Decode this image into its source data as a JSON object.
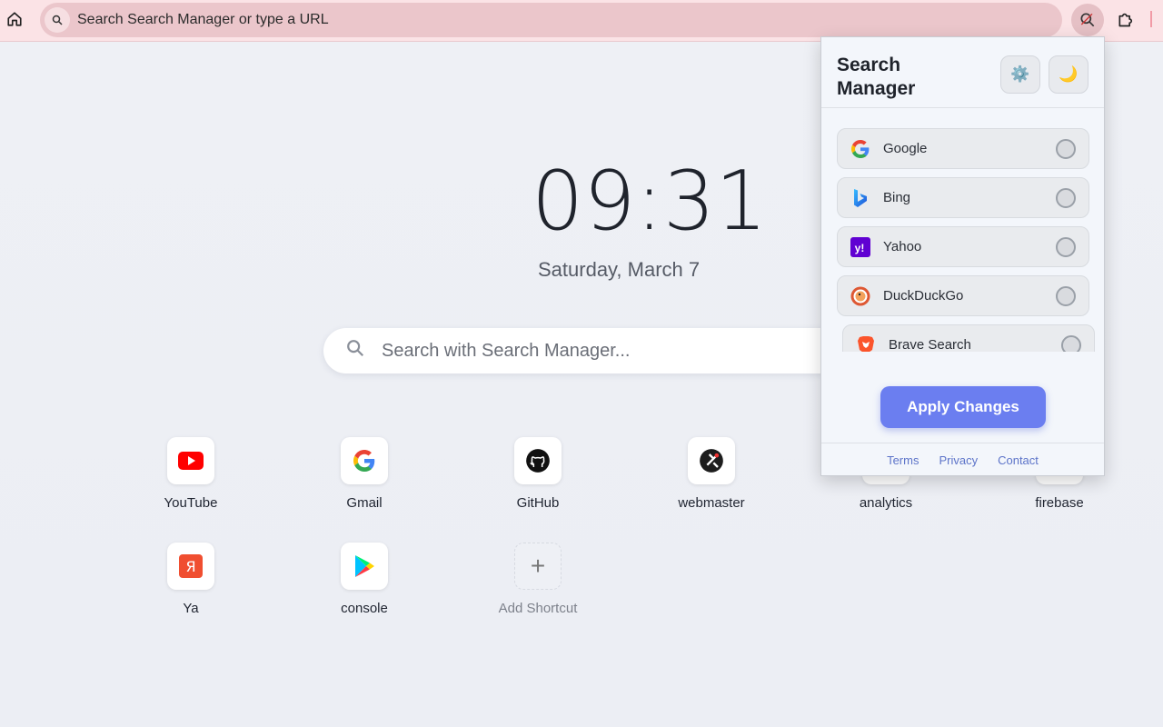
{
  "browser": {
    "omnibox_text": "Search Search Manager or type a URL"
  },
  "newtab": {
    "time": "09:31",
    "date": "Saturday, March 7",
    "search_placeholder": "Search with Search Manager...",
    "shortcuts": [
      {
        "label": "YouTube",
        "icon": "youtube-icon"
      },
      {
        "label": "Gmail",
        "icon": "google-icon"
      },
      {
        "label": "GitHub",
        "icon": "github-icon"
      },
      {
        "label": "webmaster",
        "icon": "webmaster-icon"
      },
      {
        "label": "analytics",
        "icon": "analytics-icon"
      },
      {
        "label": "firebase",
        "icon": "firebase-icon"
      },
      {
        "label": "Ya",
        "icon": "yandex-icon"
      },
      {
        "label": "console",
        "icon": "google-play-icon"
      }
    ],
    "add_shortcut_label": "Add Shortcut"
  },
  "popup": {
    "title": "Search Manager",
    "settings_icon": "gear-icon",
    "theme_icon": "moon-icon",
    "engines": [
      {
        "name": "Google",
        "icon": "google-icon",
        "selected": false
      },
      {
        "name": "Bing",
        "icon": "bing-icon",
        "selected": false
      },
      {
        "name": "Yahoo",
        "icon": "yahoo-icon",
        "selected": false
      },
      {
        "name": "DuckDuckGo",
        "icon": "duckduckgo-icon",
        "selected": false
      },
      {
        "name": "Brave Search",
        "icon": "brave-icon",
        "selected": false
      }
    ],
    "apply_label": "Apply Changes",
    "footer": {
      "terms": "Terms",
      "privacy": "Privacy",
      "contact": "Contact"
    }
  },
  "colors": {
    "accent": "#6b7ef0",
    "topbar": "#fbe3e6",
    "omnibox": "#ebc6cb",
    "link": "#5d74c9"
  }
}
